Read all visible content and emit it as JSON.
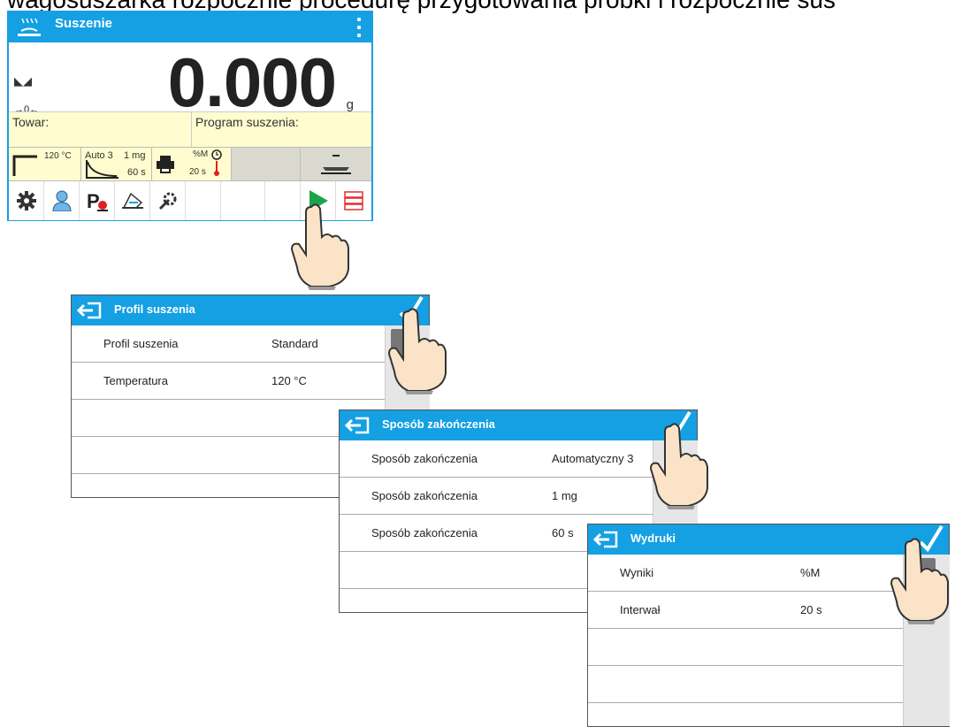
{
  "caption": "wagosuszarka rozpocznie procedurę przygotowania próbki i rozpocznie sus",
  "main_screen": {
    "title": "Suszenie",
    "mass_value": "0.000",
    "unit": "g",
    "zero_symbol": "→0←",
    "towar_label": "Towar:",
    "program_label": "Program suszenia:",
    "params": {
      "temperature": "120 °C",
      "end_mode": "Auto 3",
      "end_mass": "1 mg",
      "end_time": "60 s",
      "print_result": "%M",
      "print_interval": "20 s"
    }
  },
  "dialogs": [
    {
      "title": "Profil suszenia",
      "rows": [
        {
          "label": "Profil suszenia",
          "value": "Standard"
        },
        {
          "label": "Temperatura",
          "value": "120 °C"
        },
        {
          "label": "",
          "value": ""
        },
        {
          "label": "",
          "value": ""
        }
      ]
    },
    {
      "title": "Sposób zakończenia",
      "rows": [
        {
          "label": "Sposób zakończenia",
          "value": "Automatyczny 3"
        },
        {
          "label": "Sposób zakończenia",
          "value": "1 mg"
        },
        {
          "label": "Sposób zakończenia",
          "value": "60 s"
        },
        {
          "label": "",
          "value": ""
        }
      ]
    },
    {
      "title": "Wydruki",
      "rows": [
        {
          "label": "Wyniki",
          "value": "%M"
        },
        {
          "label": "Interwał",
          "value": "20 s"
        },
        {
          "label": "",
          "value": ""
        },
        {
          "label": "",
          "value": ""
        },
        {
          "label": "",
          "value": ""
        }
      ]
    }
  ],
  "colors": {
    "header_blue": "#14a0e3",
    "info_yellow": "#fffccf",
    "start_green": "#1fa34a"
  },
  "icons": [
    "dryer-icon",
    "kebab-menu-icon",
    "stable-indicator-icon",
    "gear-icon",
    "user-icon",
    "profile-p-icon",
    "sample-pan-icon",
    "tools-icon",
    "start-play-icon",
    "database-icon",
    "back-exit-icon",
    "checkmark-icon",
    "pointing-hand-icon"
  ]
}
